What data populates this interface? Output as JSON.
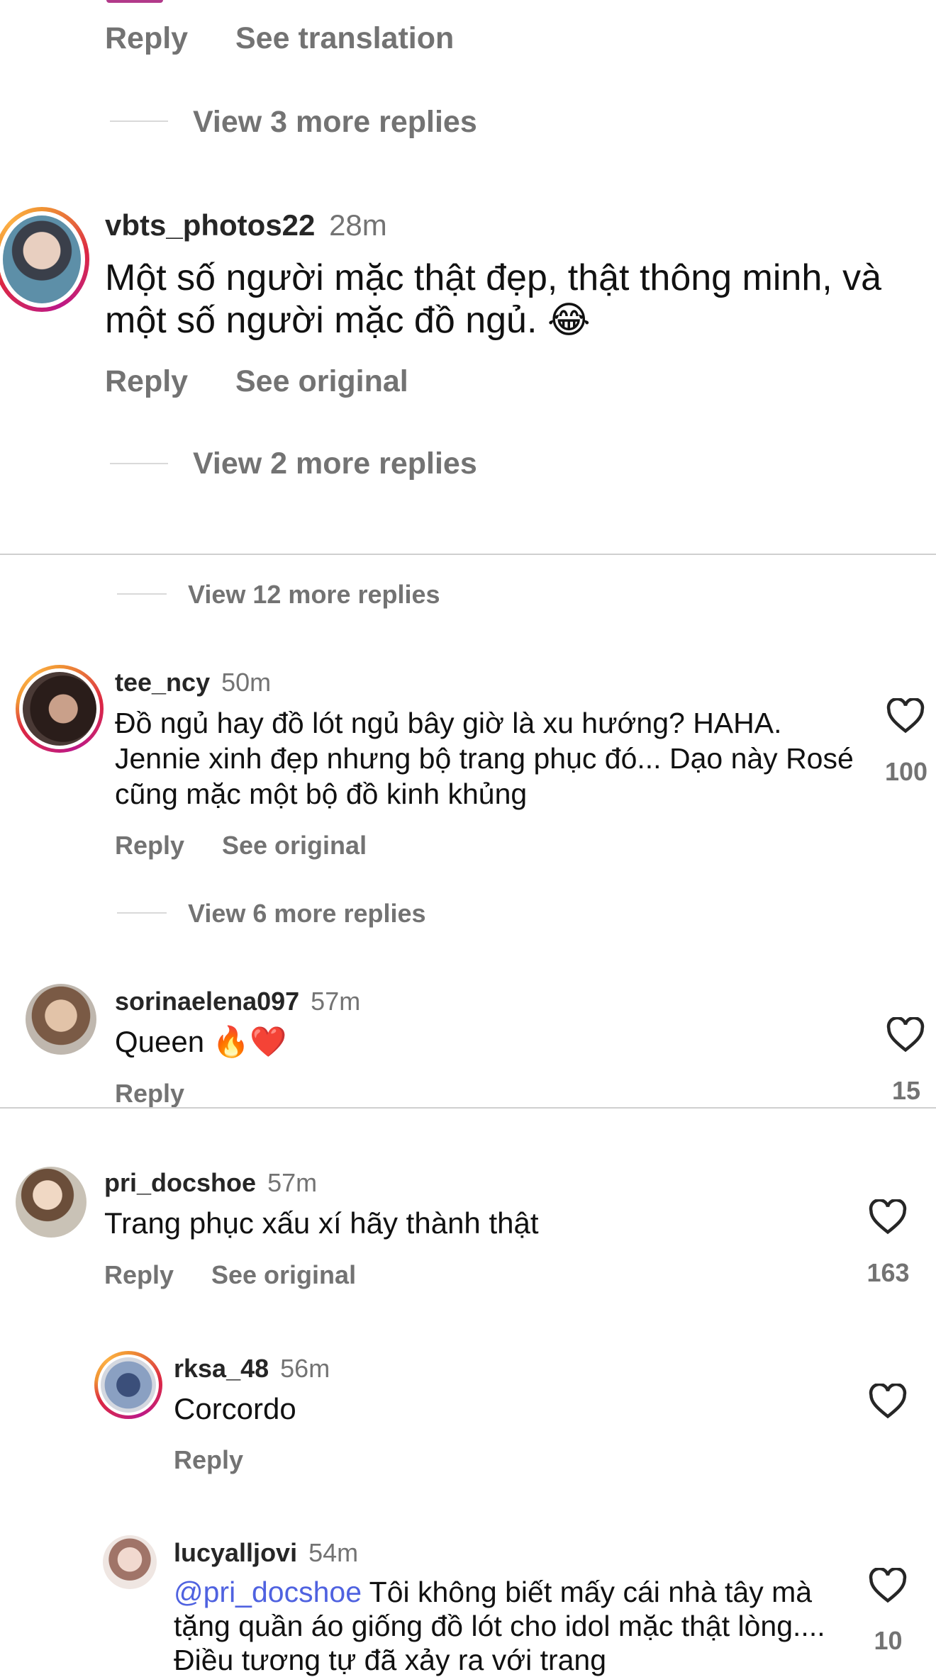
{
  "top": {
    "reply": "Reply",
    "see_translation": "See translation",
    "view_more": "View 3 more replies"
  },
  "c1": {
    "username": "vbts_photos22",
    "time": "28m",
    "text": "Một số người mặc thật đẹp, thật thông minh, và một số người mặc đồ ngủ.",
    "emoji": "😂",
    "reply": "Reply",
    "see_original": "See original",
    "view_more": "View 2 more replies"
  },
  "sec2": {
    "view_more": "View 12 more replies"
  },
  "c2": {
    "username": "tee_ncy",
    "time": "50m",
    "text": "Đồ ngủ hay đồ lót ngủ bây giờ là xu hướng? HAHA. Jennie xinh đẹp nhưng bộ trang phục đó... Dạo này Rosé cũng mặc một bộ đồ kinh khủng",
    "likes": "100",
    "reply": "Reply",
    "see_original": "See original",
    "view_more": "View 6 more replies"
  },
  "c3": {
    "username": "sorinaelena097",
    "time": "57m",
    "text": "Queen",
    "emoji": "🔥❤️",
    "likes": "15",
    "reply": "Reply"
  },
  "c4": {
    "username": "pri_docshoe",
    "time": "57m",
    "text": "Trang phục xấu xí hãy thành thật",
    "likes": "163",
    "reply": "Reply",
    "see_original": "See original"
  },
  "c5": {
    "username": "rksa_48",
    "time": "56m",
    "text": "Corcordo",
    "reply": "Reply"
  },
  "c6": {
    "username": "lucyalljovi",
    "time": "54m",
    "mention": "@pri_docshoe",
    "text": "Tôi không biết mấy cái nhà tây mà tặng quần áo giống đồ lót cho idol mặc thật lòng.... Điều tương tự đã xảy ra với trang",
    "likes": "10"
  },
  "icons": {
    "heart": "heart-outline-icon"
  }
}
